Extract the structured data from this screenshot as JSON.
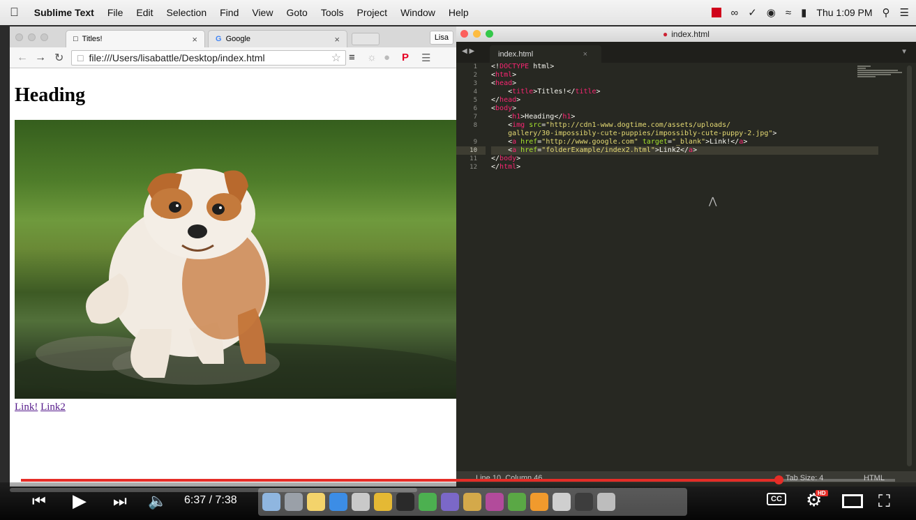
{
  "menubar": {
    "app_name": "Sublime Text",
    "items": [
      "File",
      "Edit",
      "Selection",
      "Find",
      "View",
      "Goto",
      "Tools",
      "Project",
      "Window",
      "Help"
    ],
    "clock": "Thu 1:09 PM"
  },
  "chrome": {
    "tabs": [
      {
        "label": "Titles!"
      },
      {
        "label": "Google"
      }
    ],
    "profile": "Lisa",
    "url": "file:///Users/lisabattle/Desktop/index.html",
    "page": {
      "heading": "Heading",
      "image_alt": "bulldog puppy standing in water",
      "link1": "Link!",
      "link2": "Link2"
    }
  },
  "sublime": {
    "window_title": "index.html",
    "tab_label": "index.html",
    "line_numbers": [
      "1",
      "2",
      "3",
      "4",
      "5",
      "6",
      "7",
      "8",
      "",
      "9",
      "10",
      "11",
      "12"
    ],
    "current_line": "10",
    "status_left": "Line 10, Column 46",
    "tab_size": "Tab Size: 4",
    "syntax": "HTML"
  },
  "player": {
    "time": "6:37 / 7:38",
    "progress_fraction": 0.867,
    "cc_label": "CC",
    "hd_label": "HD",
    "accent_color": "#e52d27"
  }
}
